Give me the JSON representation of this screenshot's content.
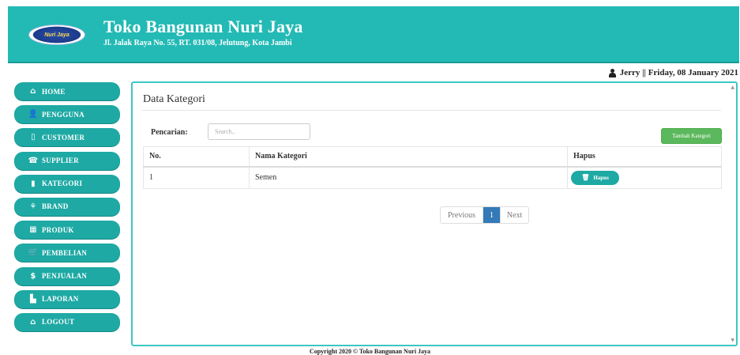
{
  "header": {
    "logo_text": "Nuri Jaya",
    "title": "Toko Bangunan Nuri Jaya",
    "address": "Jl. Jalak Raya No. 55, RT. 031/08, Jelutung, Kota Jambi",
    "bg_color": "#23bab5"
  },
  "userbar": {
    "text": "Jerry || Friday, 08 January 2021",
    "icon": "user-icon"
  },
  "sidebar": {
    "items": [
      {
        "label": "HOME",
        "icon": "home-icon",
        "glyph": "⌂"
      },
      {
        "label": "PENGGUNA",
        "icon": "user-icon",
        "glyph": "👤"
      },
      {
        "label": "CUSTOMER",
        "icon": "tablet-icon",
        "glyph": "▯"
      },
      {
        "label": "SUPPLIER",
        "icon": "phone-icon",
        "glyph": "☎"
      },
      {
        "label": "KATEGORI",
        "icon": "bookmark-icon",
        "glyph": "▮"
      },
      {
        "label": "BRAND",
        "icon": "grain-icon",
        "glyph": "⚘"
      },
      {
        "label": "PRODUK",
        "icon": "grid-icon",
        "glyph": "▦"
      },
      {
        "label": "PEMBELIAN",
        "icon": "cart-icon",
        "glyph": "🛒"
      },
      {
        "label": "PENJUALAN",
        "icon": "dollar-icon",
        "glyph": "$"
      },
      {
        "label": "LAPORAN",
        "icon": "file-icon",
        "glyph": "▙"
      },
      {
        "label": "LOGOUT",
        "icon": "home-icon",
        "glyph": "⌂"
      }
    ],
    "color": "#1ea9a4"
  },
  "main": {
    "title": "Data Kategori",
    "search": {
      "label": "Pencarian:",
      "placeholder": "Search.."
    },
    "add_button": "Tambah Kategori",
    "table": {
      "headers": [
        "No.",
        "Nama Kategori",
        "Hapus"
      ],
      "rows": [
        {
          "no": "1",
          "nama": "Semen",
          "action": "Hapus"
        }
      ]
    },
    "pagination": {
      "previous": "Previous",
      "current": "1",
      "next": "Next"
    }
  },
  "footer": {
    "text": "Copyright 2020 © Toko Bangunan Nuri Jaya"
  }
}
